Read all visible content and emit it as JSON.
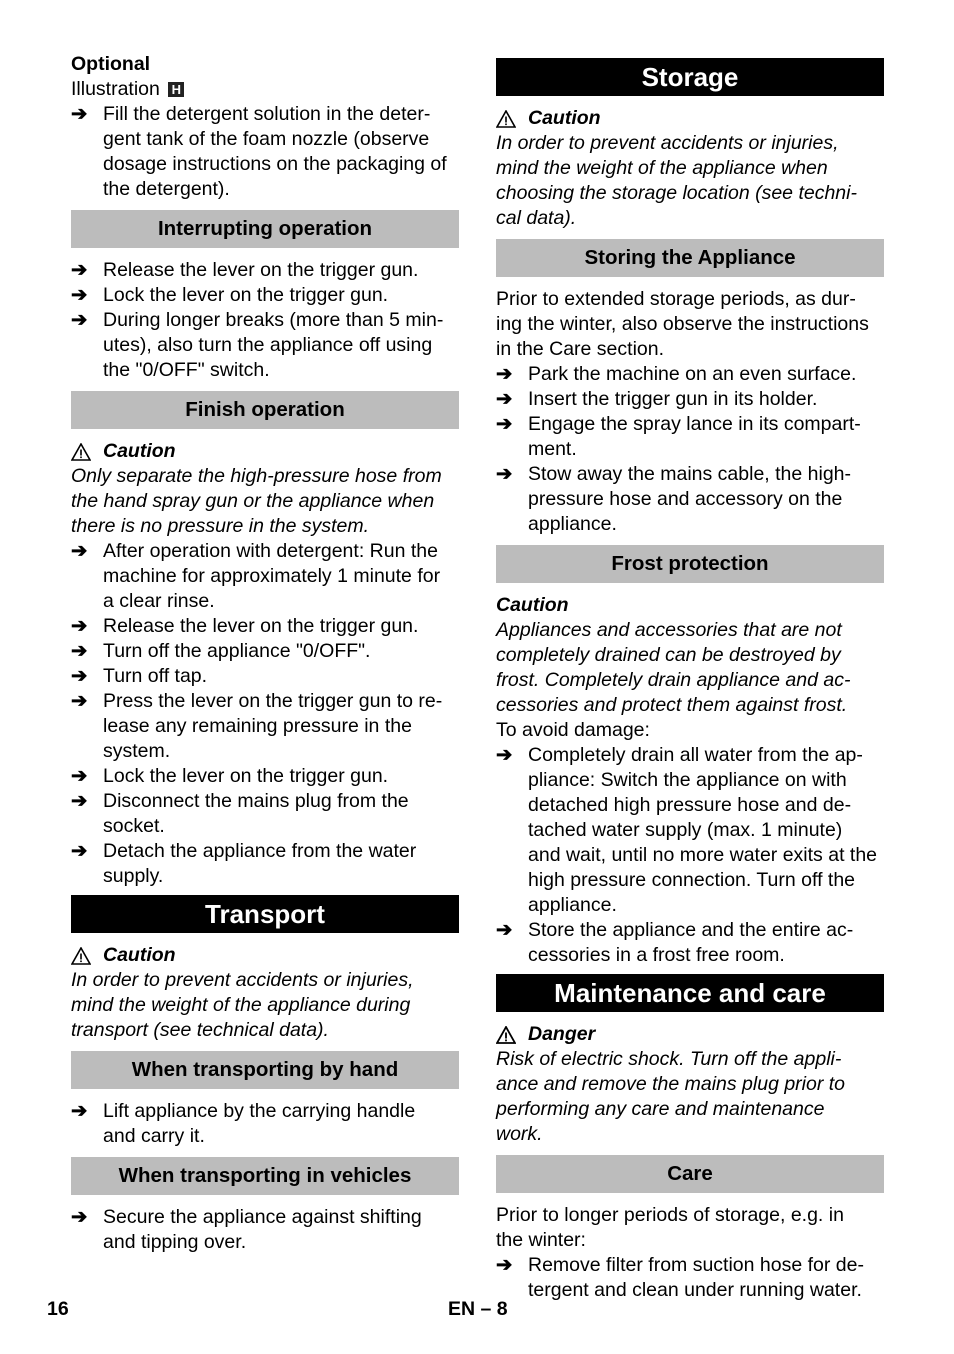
{
  "left": {
    "optional": {
      "title": "Optional",
      "illustration": "Illustration",
      "illustration_ref": "H",
      "items": [
        "Fill the detergent solution in the deter-\ngent tank of the foam nozzle (observe\ndosage instructions on the packaging of\nthe detergent)."
      ]
    },
    "interrupting": {
      "heading": "Interrupting operation",
      "items": [
        "Release the lever on the trigger gun.",
        "Lock the lever on the trigger gun.",
        "During longer breaks (more than 5 min-\nutes), also turn the appliance off using\nthe \"0/OFF\" switch."
      ]
    },
    "finish": {
      "heading": "Finish operation",
      "caution_label": "Caution",
      "caution_text": "Only separate the high-pressure hose from\nthe hand spray gun or the appliance when\nthere is no pressure in the system.",
      "items": [
        "After operation with detergent: Run the\nmachine for approximately 1 minute for\na clear rinse.",
        "Release the lever on the trigger gun.",
        "Turn off the appliance \"0/OFF\".",
        "Turn off tap.",
        "Press the lever on the trigger gun to re-\nlease any remaining pressure in the\nsystem.",
        "Lock the lever on the trigger gun.",
        "Disconnect the mains plug from the\nsocket.",
        "Detach the appliance from the water\nsupply."
      ]
    },
    "transport": {
      "heading": "Transport",
      "caution_label": "Caution",
      "caution_text": "In order to prevent accidents or injuries,\nmind the weight of the appliance during\ntransport (see technical data).",
      "by_hand": {
        "heading": "When transporting by hand",
        "items": [
          "Lift appliance by the carrying handle\nand carry it."
        ]
      },
      "vehicles": {
        "heading": "When transporting in vehicles",
        "items": [
          "Secure the appliance against shifting\nand tipping over."
        ]
      }
    }
  },
  "right": {
    "storage": {
      "heading": "Storage",
      "caution_label": "Caution",
      "caution_text": "In order to prevent accidents or injuries,\nmind the weight of the appliance when\nchoosing the storage location (see techni-\ncal data).",
      "storing": {
        "heading": "Storing the Appliance",
        "intro": "Prior to extended storage periods, as dur-\ning the winter, also observe the instructions\nin the Care section.",
        "items": [
          "Park the machine on an even surface.",
          "Insert the trigger gun in its holder.",
          "Engage the spray lance in its compart-\nment.",
          "Stow away the mains cable, the high-\npressure hose and accessory on the\nappliance."
        ]
      },
      "frost": {
        "heading": "Frost protection",
        "caution_label": "Caution",
        "caution_text": "Appliances and accessories that are not\ncompletely drained can be destroyed by\nfrost. Completely drain appliance and ac-\ncessories and protect them against frost.",
        "intro": "To avoid damage:",
        "items": [
          "Completely drain all water from the ap-\npliance: Switch the appliance on with\ndetached high pressure hose and de-\ntached water supply (max. 1 minute)\nand wait, until no more water exits at the\nhigh pressure connection. Turn off the\nappliance.",
          "Store the appliance and the entire ac-\ncessories in a frost free room."
        ]
      }
    },
    "maintenance": {
      "heading": "Maintenance and care",
      "danger_label": "Danger",
      "danger_text": "Risk of electric shock. Turn off the appli-\nance and remove the mains plug prior to\nperforming any care and maintenance\nwork.",
      "care": {
        "heading": "Care",
        "intro": "Prior to longer periods of storage, e.g. in\nthe winter:",
        "items": [
          "Remove filter from suction hose for de-\ntergent and clean under running water."
        ]
      }
    }
  },
  "footer": {
    "page_number": "16",
    "section_page": "EN – 8"
  },
  "icons": {
    "bullet": "➔"
  }
}
